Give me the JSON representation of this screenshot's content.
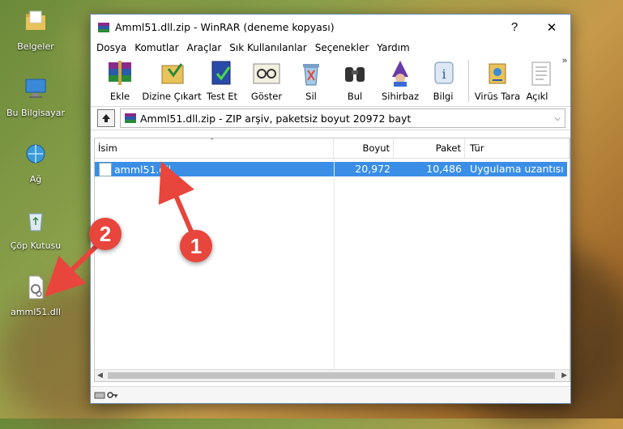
{
  "desktop": {
    "icons": [
      {
        "label": "Belgeler"
      },
      {
        "label": "Bu Bilgisayar"
      },
      {
        "label": "Ağ"
      },
      {
        "label": "Çöp Kutusu"
      },
      {
        "label": "amml51.dll"
      }
    ]
  },
  "window": {
    "title": "Amml51.dll.zip - WinRAR (deneme kopyası)",
    "help_label": "?",
    "close_label": "✕",
    "menu": [
      "Dosya",
      "Komutlar",
      "Araçlar",
      "Sık Kullanılanlar",
      "Seçenekler",
      "Yardım"
    ],
    "toolbar": [
      {
        "label": "Ekle",
        "icon": "add-books-icon"
      },
      {
        "label": "Dizine Çıkart",
        "icon": "extract-folder-icon"
      },
      {
        "label": "Test Et",
        "icon": "test-icon"
      },
      {
        "label": "Göster",
        "icon": "view-icon"
      },
      {
        "label": "Sil",
        "icon": "delete-icon"
      },
      {
        "label": "Bul",
        "icon": "find-icon"
      },
      {
        "label": "Sihirbaz",
        "icon": "wizard-icon"
      },
      {
        "label": "Bilgi",
        "icon": "info-icon"
      },
      {
        "label": "Virüs Tara",
        "icon": "virus-scan-icon"
      },
      {
        "label": "Açıkl",
        "icon": "comment-icon"
      }
    ],
    "more_label": "»",
    "address": "Amml51.dll.zip - ZIP arşiv, paketsiz boyut 20972 bayt",
    "columns": {
      "name": "İsim",
      "size": "Boyut",
      "packed": "Paket",
      "type": "Tür"
    },
    "files": [
      {
        "name": "amml51.dll",
        "size": "20,972",
        "packed": "10,486",
        "type": "Uygulama uzantısı"
      }
    ]
  },
  "annotations": {
    "step1": "1",
    "step2": "2"
  },
  "colors": {
    "selection": "#3a8ee6",
    "badge": "#e8453c"
  }
}
